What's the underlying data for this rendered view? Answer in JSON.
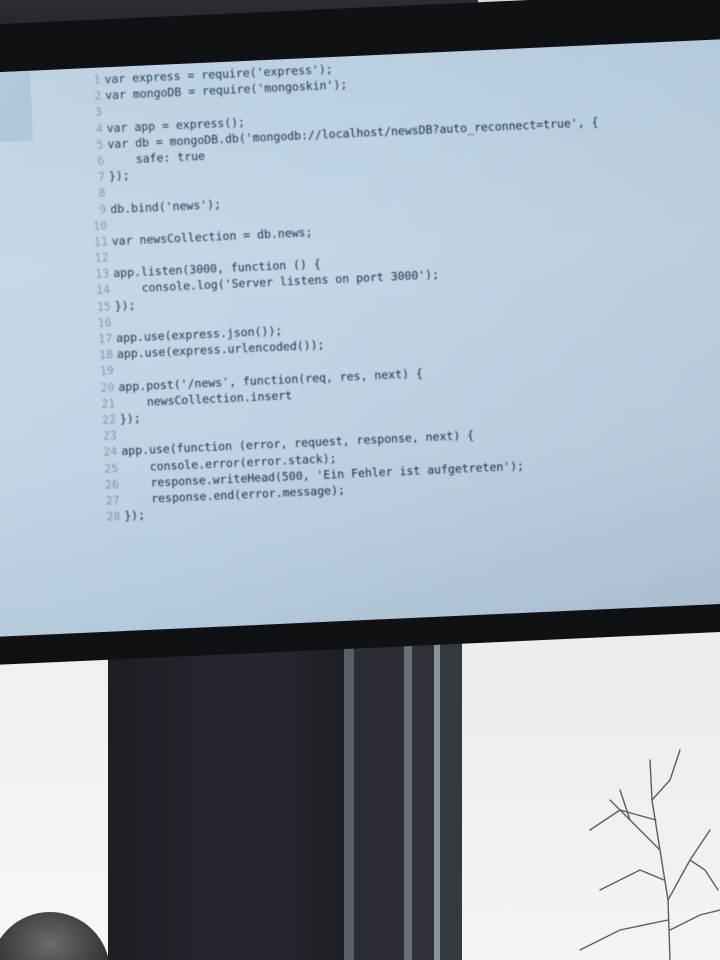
{
  "code_editor": {
    "lines": [
      {
        "num": "1",
        "text": "var express = require('express');"
      },
      {
        "num": "2",
        "text": "var mongoDB = require('mongoskin');"
      },
      {
        "num": "3",
        "text": ""
      },
      {
        "num": "4",
        "text": "var app = express();"
      },
      {
        "num": "5",
        "text": "var db = mongoDB.db('mongodb://localhost/newsDB?auto_reconnect=true', {"
      },
      {
        "num": "6",
        "text": "    safe: true"
      },
      {
        "num": "7",
        "text": "});"
      },
      {
        "num": "8",
        "text": ""
      },
      {
        "num": "9",
        "text": "db.bind('news');"
      },
      {
        "num": "10",
        "text": ""
      },
      {
        "num": "11",
        "text": "var newsCollection = db.news;"
      },
      {
        "num": "12",
        "text": ""
      },
      {
        "num": "13",
        "text": "app.listen(3000, function () {"
      },
      {
        "num": "14",
        "text": "    console.log('Server listens on port 3000');"
      },
      {
        "num": "15",
        "text": "});"
      },
      {
        "num": "16",
        "text": ""
      },
      {
        "num": "17",
        "text": "app.use(express.json());"
      },
      {
        "num": "18",
        "text": "app.use(express.urlencoded());"
      },
      {
        "num": "19",
        "text": ""
      },
      {
        "num": "20",
        "text": "app.post('/news', function(req, res, next) {"
      },
      {
        "num": "21",
        "text": "    newsCollection.insert"
      },
      {
        "num": "22",
        "text": "});"
      },
      {
        "num": "23",
        "text": ""
      },
      {
        "num": "24",
        "text": "app.use(function (error, request, response, next) {"
      },
      {
        "num": "25",
        "text": "    console.error(error.stack);"
      },
      {
        "num": "26",
        "text": "    response.writeHead(500, 'Ein Fehler ist aufgetreten');"
      },
      {
        "num": "27",
        "text": "    response.end(error.message);"
      },
      {
        "num": "28",
        "text": "});"
      }
    ]
  },
  "colors": {
    "screen_bg": "#c0d4e5",
    "code_text": "#1e2b44",
    "keyword": "#1c3fb0",
    "line_number": "#7f95ad"
  }
}
